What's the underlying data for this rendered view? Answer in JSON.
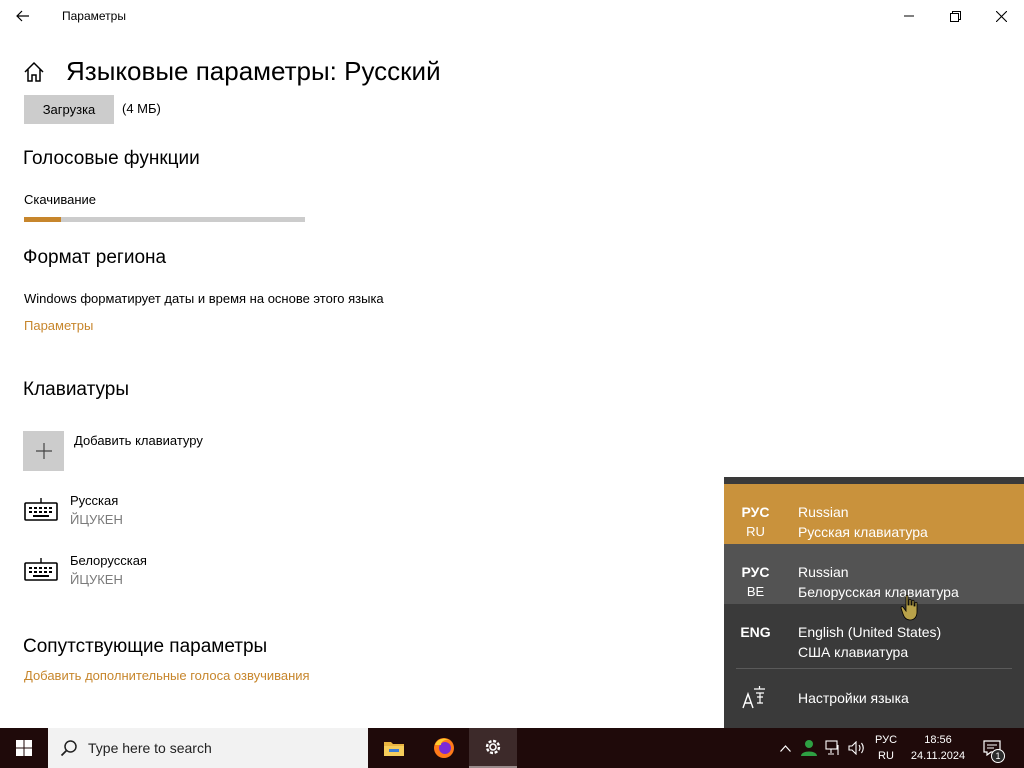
{
  "window": {
    "title": "Параметры",
    "back_icon": "back-arrow-icon",
    "controls": [
      "minimize-icon",
      "maximize-icon",
      "close-icon"
    ]
  },
  "page": {
    "title": "Языковые параметры: Русский",
    "download_button": "Загрузка",
    "download_size": "(4 МБ)"
  },
  "voice": {
    "heading": "Голосовые функции",
    "status": "Скачивание",
    "progress_percent": 13
  },
  "region": {
    "heading": "Формат региона",
    "description": "Windows форматирует даты и время на основе этого языка",
    "link": "Параметры"
  },
  "keyboards": {
    "heading": "Клавиатуры",
    "add_label": "Добавить клавиатуру",
    "items": [
      {
        "name": "Русская",
        "layout": "ЙЦУКЕН"
      },
      {
        "name": "Белорусская",
        "layout": "ЙЦУКЕН"
      }
    ]
  },
  "related": {
    "heading": "Сопутствующие параметры",
    "link": "Добавить дополнительные голоса озвучивания"
  },
  "lang_flyout": {
    "items": [
      {
        "abbr": "РУС",
        "region": "RU",
        "name": "Russian",
        "keyboard": "Русская клавиатура",
        "state": "selected"
      },
      {
        "abbr": "РУС",
        "region": "BE",
        "name": "Russian",
        "keyboard": "Белорусская клавиатура",
        "state": "hover"
      },
      {
        "abbr": "ENG",
        "region": "",
        "name": "English (United States)",
        "keyboard": "США клавиатура",
        "state": "normal"
      }
    ],
    "settings_label": "Настройки языка"
  },
  "taskbar": {
    "search_placeholder": "Type here to search",
    "apps": [
      "file-explorer-icon",
      "firefox-icon",
      "settings-gear-icon"
    ],
    "tray_lang_top": "РУС",
    "tray_lang_bottom": "RU",
    "time": "18:56",
    "date": "24.11.2024",
    "notification_count": "1"
  },
  "colors": {
    "accent": "#c7862c",
    "flyout_bg": "#3a3a3a",
    "flyout_selected": "#c9923c",
    "taskbar_bg": "#1f0a0a"
  }
}
